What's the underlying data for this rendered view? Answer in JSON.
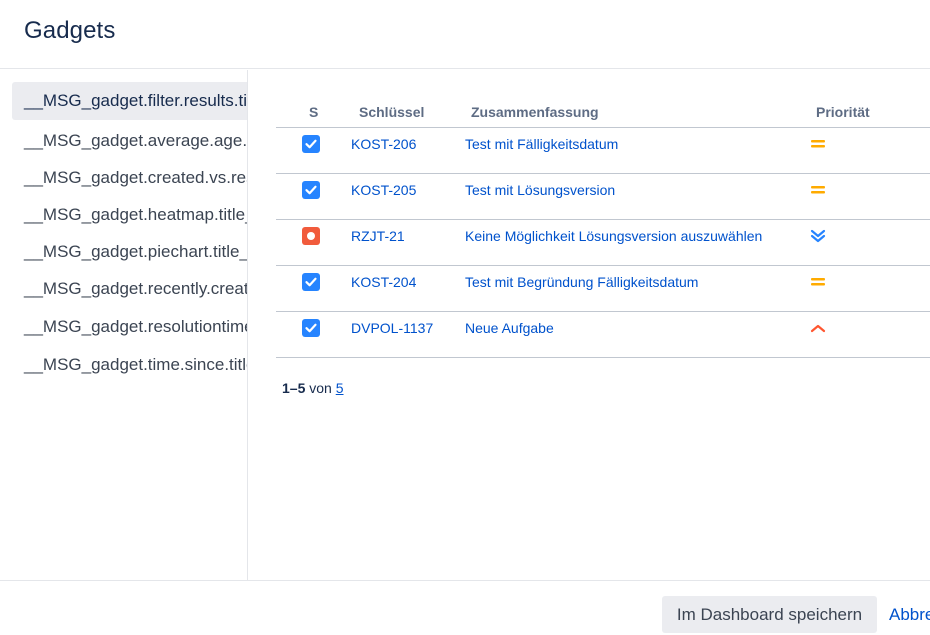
{
  "page": {
    "title": "Gadgets"
  },
  "sidebar": {
    "items": [
      {
        "label": "__MSG_gadget.filter.results.title__"
      },
      {
        "label": "__MSG_gadget.average.age.title__"
      },
      {
        "label": "__MSG_gadget.created.vs.resolved.title__"
      },
      {
        "label": "__MSG_gadget.heatmap.title__"
      },
      {
        "label": "__MSG_gadget.piechart.title__"
      },
      {
        "label": "__MSG_gadget.recently.created.title__"
      },
      {
        "label": "__MSG_gadget.resolutiontime.title__"
      },
      {
        "label": "__MSG_gadget.time.since.title__"
      }
    ]
  },
  "table": {
    "columns": {
      "type": "S",
      "key": "Schlüssel",
      "summary": "Zusammenfassung",
      "priority": "Priorität"
    },
    "rows": [
      {
        "type_icon": "task-checkbox-icon",
        "key": "KOST-206",
        "summary": "Test mit Fälligkeitsdatum",
        "priority_icon": "priority-medium-icon"
      },
      {
        "type_icon": "task-checkbox-icon",
        "key": "KOST-205",
        "summary": "Test mit Lösungsversion",
        "priority_icon": "priority-medium-icon"
      },
      {
        "type_icon": "bug-icon",
        "key": "RZJT-21",
        "summary": "Keine Möglichkeit Lösungsversion auszuwählen",
        "priority_icon": "priority-lowest-icon"
      },
      {
        "type_icon": "task-checkbox-icon",
        "key": "KOST-204",
        "summary": "Test mit Begründung Fälligkeitsdatum",
        "priority_icon": "priority-medium-icon"
      },
      {
        "type_icon": "task-checkbox-icon",
        "key": "DVPOL-1137",
        "summary": "Neue Aufgabe",
        "priority_icon": "priority-high-icon"
      }
    ]
  },
  "pagination": {
    "range": "1–5",
    "of_label": "von",
    "total": "5"
  },
  "footer": {
    "save_label": "Im Dashboard speichern",
    "cancel_label": "Abbrechen"
  },
  "colors": {
    "task": "#2684ff",
    "bug": "#f15b3c",
    "medium": "#ffab00",
    "lowest": "#2684ff",
    "high": "#ff5630",
    "link": "#0052cc"
  }
}
